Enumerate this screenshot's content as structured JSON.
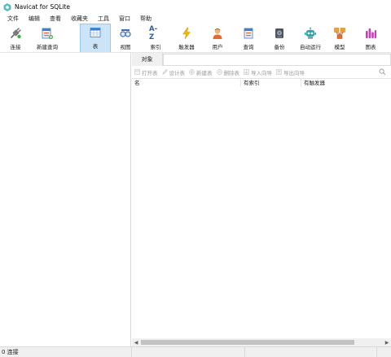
{
  "window": {
    "title": "Navicat for SQLite"
  },
  "menu": [
    "文件",
    "编辑",
    "查看",
    "收藏夹",
    "工具",
    "窗口",
    "帮助"
  ],
  "toolbar": {
    "connect": "连接",
    "new_query": "新建查询",
    "table": "表",
    "view": "视图",
    "index": "索引",
    "trigger": "触发器",
    "user": "用户",
    "query": "查询",
    "backup": "备份",
    "automation": "自动运行",
    "model": "模型",
    "chart": "图表",
    "index_icon_text": "A-Z"
  },
  "objects": {
    "tab_label": "对象",
    "actions": {
      "open_table": "打开表",
      "design_table": "设计表",
      "new_table": "新建表",
      "delete_table": "删除表",
      "import_wizard": "导入向导",
      "export_wizard": "导出向导"
    },
    "columns": [
      "名",
      "有索引",
      "有触发器"
    ]
  },
  "status": {
    "connections": "0 连接"
  }
}
